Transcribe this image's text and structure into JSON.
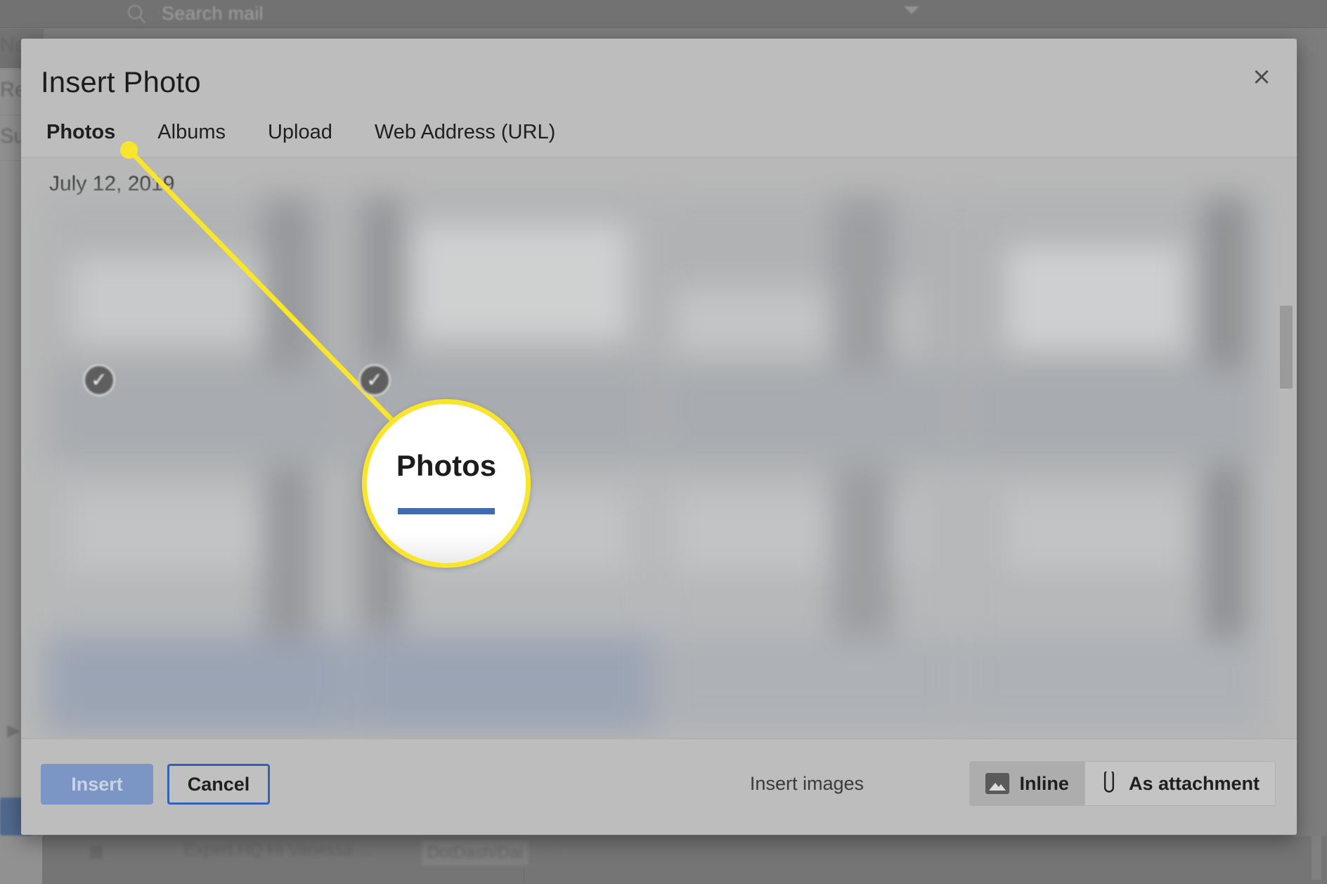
{
  "background": {
    "search_placeholder": "Search mail",
    "search_icon": "search-icon",
    "caret_icon": "chevron-down-icon",
    "compose_labels": [
      "Ne",
      "Re",
      "Su"
    ],
    "mail_row": {
      "subject": "Expert HQ Hi Vanessa ...",
      "tag": "DotDash/Dai",
      "star_icon": "star-icon"
    },
    "close_icon": "close-icon"
  },
  "dialog": {
    "title": "Insert Photo",
    "close_label": "×",
    "close_icon": "close-icon",
    "tabs": [
      {
        "label": "Photos",
        "active": true
      },
      {
        "label": "Albums",
        "active": false
      },
      {
        "label": "Upload",
        "active": false
      },
      {
        "label": "Web Address (URL)",
        "active": false
      }
    ],
    "content": {
      "date_label": "July 12, 2019",
      "selected_check_icon": "check-circle-icon",
      "photos": [
        {
          "selected": true
        },
        {
          "selected": true
        },
        {
          "selected": false
        },
        {
          "selected": false
        },
        {
          "selected": false
        },
        {
          "selected": false
        },
        {
          "selected": false
        },
        {
          "selected": false
        }
      ]
    },
    "footer": {
      "insert_label": "Insert",
      "cancel_label": "Cancel",
      "insert_images_label": "Insert images",
      "options": [
        {
          "label": "Inline",
          "icon": "image-icon",
          "selected": true
        },
        {
          "label": "As attachment",
          "icon": "paperclip-icon",
          "selected": false
        }
      ]
    }
  },
  "callout": {
    "magnified_label": "Photos",
    "accent_color": "#f9e52b",
    "underline_color": "#3b6cb5"
  }
}
